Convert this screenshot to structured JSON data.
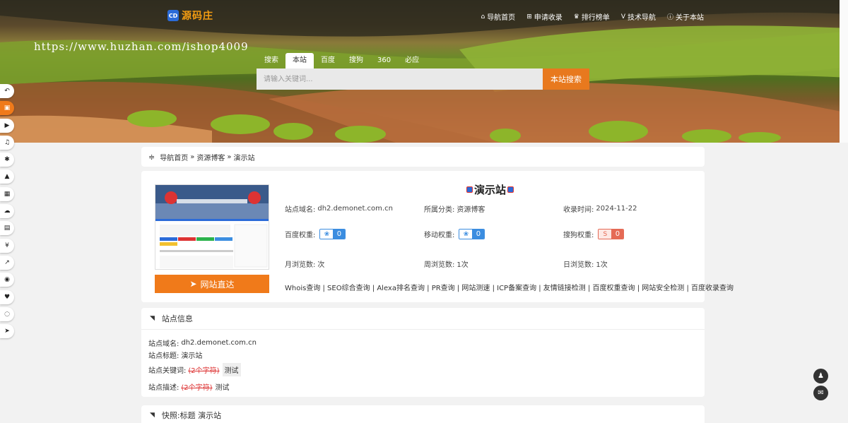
{
  "header": {
    "logo_badge": "CD",
    "logo_text": "源码庄",
    "nav": [
      {
        "icon": "home-icon",
        "label": "导航首页"
      },
      {
        "icon": "plus-square-icon",
        "label": "申请收录"
      },
      {
        "icon": "trophy-icon",
        "label": "排行榜单"
      },
      {
        "icon": "vimeo-icon",
        "label": "技术导航"
      },
      {
        "icon": "info-icon",
        "label": "关于本站"
      }
    ],
    "watermark": "https://www.huzhan.com/ishop4009"
  },
  "search": {
    "tabs": [
      "搜索",
      "本站",
      "百度",
      "搜狗",
      "360",
      "必应"
    ],
    "active_tab": "本站",
    "placeholder": "请输入关键词...",
    "button": "本站搜索"
  },
  "breadcrumb": {
    "home": "导航首页",
    "sep1": "»",
    "category": "资源博客",
    "sep2": "»",
    "current": "演示站"
  },
  "site": {
    "title": "演示站",
    "visit_button": "网站直达",
    "domain_label": "站点域名:",
    "domain": "dh2.demonet.com.cn",
    "category_label": "所属分类:",
    "category": "资源博客",
    "date_label": "收录时间:",
    "date": "2024-11-22",
    "baidu_label": "百度权重:",
    "baidu_value": "0",
    "mobile_label": "移动权重:",
    "mobile_value": "0",
    "sogou_label": "搜狗权重:",
    "sogou_value": "0",
    "sogou_icon_letter": "S",
    "month_label": "月浏览数:",
    "month_value": "次",
    "week_label": "周浏览数:",
    "week_value": "1次",
    "day_label": "日浏览数:",
    "day_value": "1次",
    "tools": "Whois查询 | SEO综合查询 | Alexa排名查询 | PR查询 | 网站测速 | ICP备案查询 | 友情链接检测 | 百度权重查询 | 网站安全检测 | 百度收录查询"
  },
  "site_info": {
    "heading": "站点信息",
    "domain_label": "站点域名:",
    "domain": "dh2.demonet.com.cn",
    "title_label": "站点标题:",
    "title": "演示站",
    "keywords_label": "站点关键词:",
    "keywords_count": "(2个字符)",
    "keywords": "测试",
    "desc_label": "站点描述:",
    "desc_count": "(2个字符)",
    "desc": "测试"
  },
  "snapshot": {
    "heading": "快照:标题 演示站"
  },
  "left_toolbar": [
    "back-icon",
    "shop-icon",
    "video-icon",
    "music-icon",
    "code-icon",
    "graduation-icon",
    "apps-icon",
    "cloud-icon",
    "document-icon",
    "yen-icon",
    "chart-icon",
    "compass-icon",
    "heartbeat-icon",
    "support-icon",
    "send-icon"
  ],
  "right_toolbar": [
    "qq-icon",
    "mail-icon"
  ],
  "colors": {
    "accent": "#f07a1a",
    "rank_blue": "#3b8de0",
    "rank_red": "#e56a55"
  }
}
